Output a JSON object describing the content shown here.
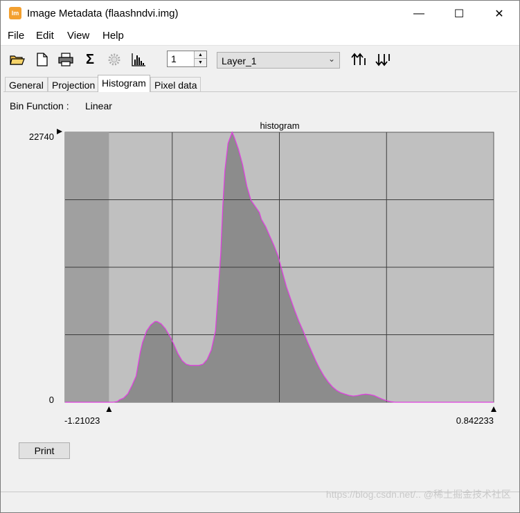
{
  "window": {
    "title": "Image Metadata (flaashndvi.img)",
    "app_icon_text": "lm",
    "controls": {
      "minimize": "—",
      "maximize": "☐",
      "close": "✕"
    }
  },
  "menu": [
    "File",
    "Edit",
    "View",
    "Help"
  ],
  "toolbar": {
    "icons": [
      "open-folder-icon",
      "new-file-icon",
      "print-icon",
      "sigma-icon",
      "settings-gear-icon",
      "histogram-icon"
    ],
    "sigma_glyph": "Σ",
    "band_spinner_value": "1",
    "layer_select": "Layer_1",
    "sort_icons": [
      "sort-ascending-icon",
      "sort-descending-icon"
    ]
  },
  "tabs": [
    {
      "label": "General",
      "active": false
    },
    {
      "label": "Projection",
      "active": false
    },
    {
      "label": "Histogram",
      "active": true
    },
    {
      "label": "Pixel data",
      "active": false
    }
  ],
  "histogram": {
    "bin_function_label": "Bin Function :",
    "bin_function_value": "Linear",
    "print_label": "Print"
  },
  "chart_data": {
    "type": "area",
    "title": "histogram",
    "xlim": [
      -1.21023,
      0.842233
    ],
    "ylim": [
      0,
      22740
    ],
    "x_tick_labels": [
      "-1.21023",
      "0.842233"
    ],
    "y_tick_labels": [
      "22740",
      "0"
    ],
    "grid": true,
    "line_color": "#e040e0",
    "fill_color": "#8c8c8c",
    "plot_background": "#c0c0c0",
    "excluded_region_color": "#a0a0a0",
    "range_marker_left": -1.21023,
    "range_marker_right": 0.842233,
    "series": [
      {
        "x": [
          -1.21023,
          -0.98,
          -0.96,
          -0.95,
          -0.93,
          -0.91,
          -0.89,
          -0.87,
          -0.86,
          -0.85,
          -0.84,
          -0.82,
          -0.8,
          -0.78,
          -0.77,
          -0.75,
          -0.73,
          -0.71,
          -0.69,
          -0.67,
          -0.65,
          -0.63,
          -0.61,
          -0.59,
          -0.57,
          -0.55,
          -0.53,
          -0.51,
          -0.49,
          -0.48,
          -0.465,
          -0.455,
          -0.445,
          -0.43,
          -0.41,
          -0.4,
          -0.38,
          -0.36,
          -0.34,
          -0.32,
          -0.3,
          -0.28,
          -0.27,
          -0.25,
          -0.23,
          -0.21,
          -0.19,
          -0.17,
          -0.15,
          -0.13,
          -0.11,
          -0.09,
          -0.07,
          -0.05,
          -0.03,
          -0.01,
          0.01,
          0.03,
          0.05,
          0.07,
          0.09,
          0.11,
          0.13,
          0.15,
          0.17,
          0.19,
          0.21,
          0.23,
          0.25,
          0.27,
          0.29,
          0.31,
          0.33,
          0.35,
          0.37,
          0.39,
          0.41,
          0.43,
          0.45,
          0.47,
          0.49,
          0.51,
          0.53,
          0.55,
          0.57,
          0.59,
          0.61,
          0.63,
          0.65,
          0.67,
          0.69,
          0.71,
          0.73,
          0.75,
          0.77,
          0.79,
          0.81,
          0.842233
        ],
        "values": [
          0,
          0,
          60,
          200,
          350,
          700,
          1400,
          2200,
          3200,
          4200,
          5000,
          6000,
          6500,
          6800,
          6800,
          6600,
          6200,
          5600,
          4900,
          4100,
          3500,
          3200,
          3100,
          3100,
          3100,
          3200,
          3600,
          4400,
          6000,
          8500,
          12500,
          16500,
          19500,
          21800,
          22740,
          22300,
          21300,
          20000,
          18200,
          17000,
          16500,
          16000,
          15400,
          14800,
          14000,
          13200,
          12300,
          11000,
          9700,
          8700,
          7700,
          6800,
          6000,
          5100,
          4300,
          3500,
          2800,
          2200,
          1700,
          1300,
          1000,
          800,
          680,
          580,
          520,
          560,
          640,
          680,
          640,
          560,
          400,
          250,
          120,
          40,
          0,
          0,
          0,
          0,
          0,
          0,
          0,
          0,
          0,
          0,
          0,
          0,
          0,
          0,
          0,
          0,
          0,
          0,
          0,
          0,
          0,
          0,
          0,
          0
        ]
      }
    ]
  },
  "watermark": "https://blog.csdn.net/..   @稀土掘金技术社区"
}
